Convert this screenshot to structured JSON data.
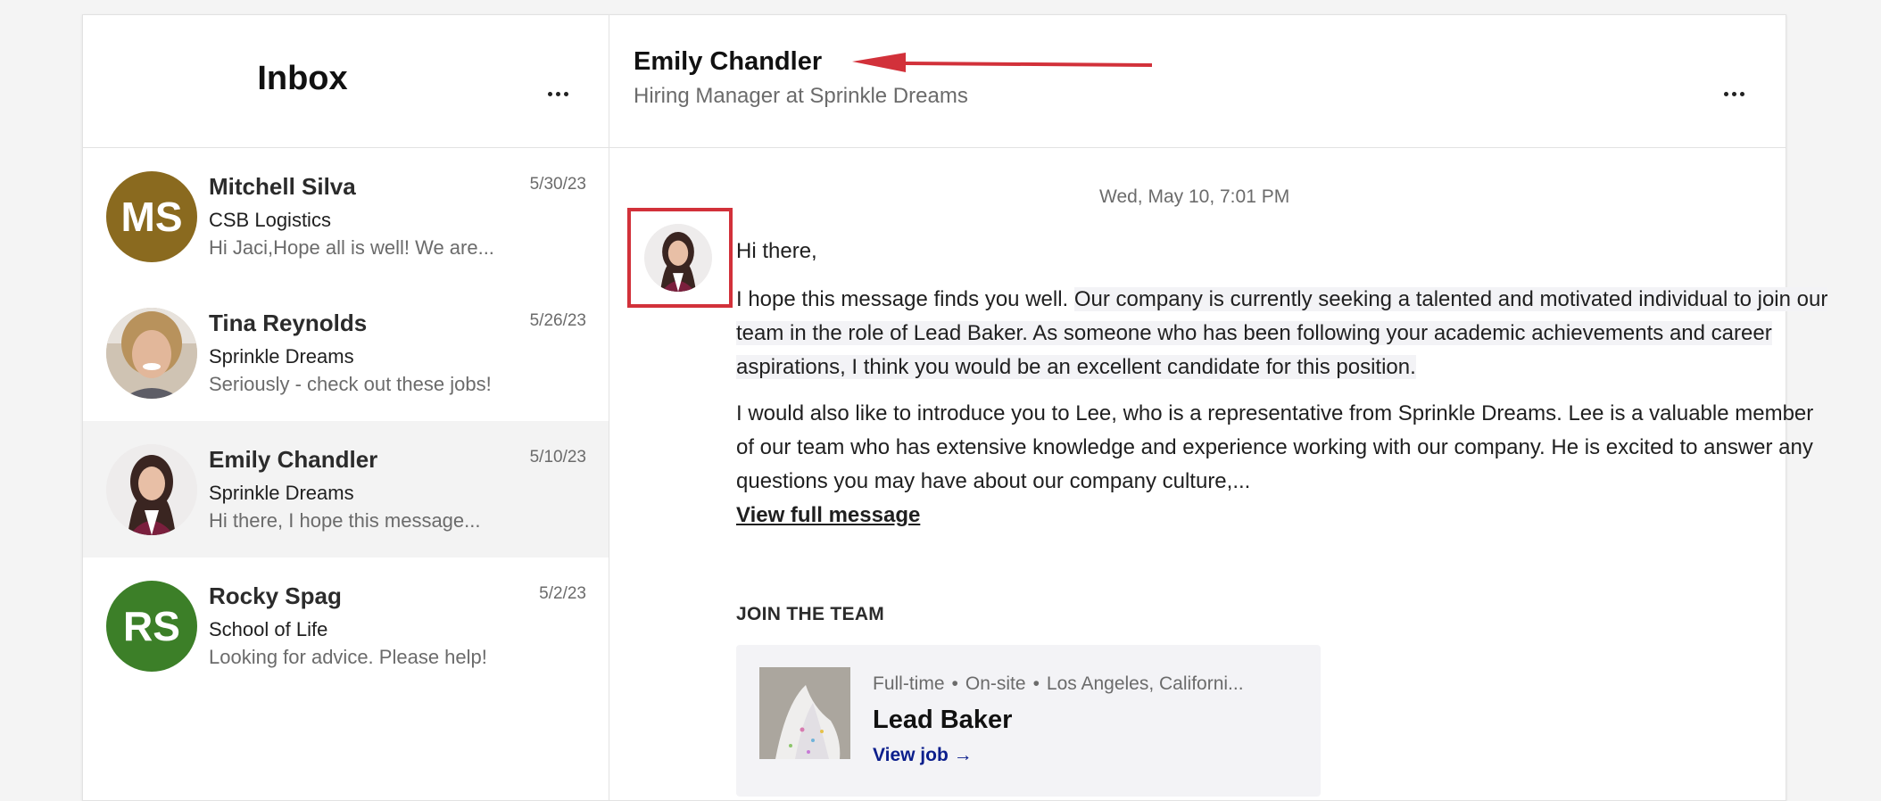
{
  "inbox": {
    "title": "Inbox"
  },
  "conversations": [
    {
      "initials": "MS",
      "name": "Mitchell Silva",
      "date": "5/30/23",
      "company": "CSB Logistics",
      "preview": "Hi Jaci,Hope all is well!  We are...",
      "avatar_color": "#8a6a1f"
    },
    {
      "initials": "",
      "name": "Tina Reynolds",
      "date": "5/26/23",
      "company": "Sprinkle Dreams",
      "preview": "Seriously - check out these jobs!",
      "avatar_color": "#c9b8a8"
    },
    {
      "initials": "",
      "name": "Emily Chandler",
      "date": "5/10/23",
      "company": "Sprinkle Dreams",
      "preview": "Hi there, I hope this message...",
      "avatar_color": "#e8e6e6"
    },
    {
      "initials": "RS",
      "name": "Rocky Spag",
      "date": "5/2/23",
      "company": "School of Life",
      "preview": "Looking for advice. Please help!",
      "avatar_color": "#3c7f28"
    }
  ],
  "chat": {
    "contact_name": "Emily Chandler",
    "contact_title": "Hiring Manager at Sprinkle Dreams",
    "message": {
      "date": "Wed, May 10, 7:01 PM",
      "greeting": "Hi there,",
      "para1_plain": "I hope this message finds you well. ",
      "para1_highlight": "Our company is currently seeking a talented and motivated individual to join our team in the role of Lead Baker. As someone who has been following your academic achievements and career aspirations, I think you would be an excellent candidate for this position.",
      "para2": "I would also like to introduce you to Lee, who is a representative from Sprinkle Dreams. Lee is a valuable member of our team who has extensive knowledge and experience working with our company. He is excited to answer any questions you may have about our company culture,...",
      "view_full_label": "View full message"
    },
    "join_title": "JOIN THE TEAM",
    "job": {
      "type": "Full-time",
      "workplace": "On-site",
      "location": "Los Angeles, Californi...",
      "title": "Lead Baker",
      "link_label": "View job →"
    }
  },
  "colors": {
    "annotation_red": "#d2313a",
    "link_blue": "#0b1e8c",
    "active_row_bg": "#f3f3f3"
  },
  "icons": {
    "more": "more-horizontal-icon",
    "annotation": "red-arrow-icon"
  }
}
